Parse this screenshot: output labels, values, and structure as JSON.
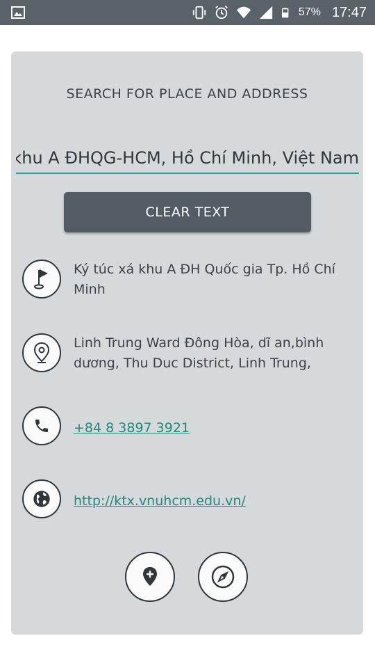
{
  "status_bar": {
    "battery_percent": "57%",
    "time": "17:47",
    "icons": [
      "image-icon",
      "vibrate-icon",
      "alarm-icon",
      "wifi-icon",
      "cell-signal-icon",
      "battery-icon"
    ]
  },
  "card": {
    "title": "SEARCH FOR PLACE AND ADDRESS",
    "search_value": "Ký túc xá khu A ĐHQG-HCM, Hồ Chí Minh, Việt Nam",
    "clear_button": "CLEAR TEXT",
    "place_name": "Ký túc xá khu A ĐH Quốc gia Tp. Hồ Chí Minh",
    "address": "Linh Trung Ward Đông Hòa, dĩ an,bình dương, Thu Duc District, Linh Trung,",
    "phone": "+84 8 3897 3921",
    "website": "http://ktx.vnuhcm.edu.vn/"
  },
  "colors": {
    "accent": "#2a9d8f",
    "card_bg": "#d6d9db",
    "button_bg": "#535c64",
    "status_bar": "#5a6269"
  }
}
